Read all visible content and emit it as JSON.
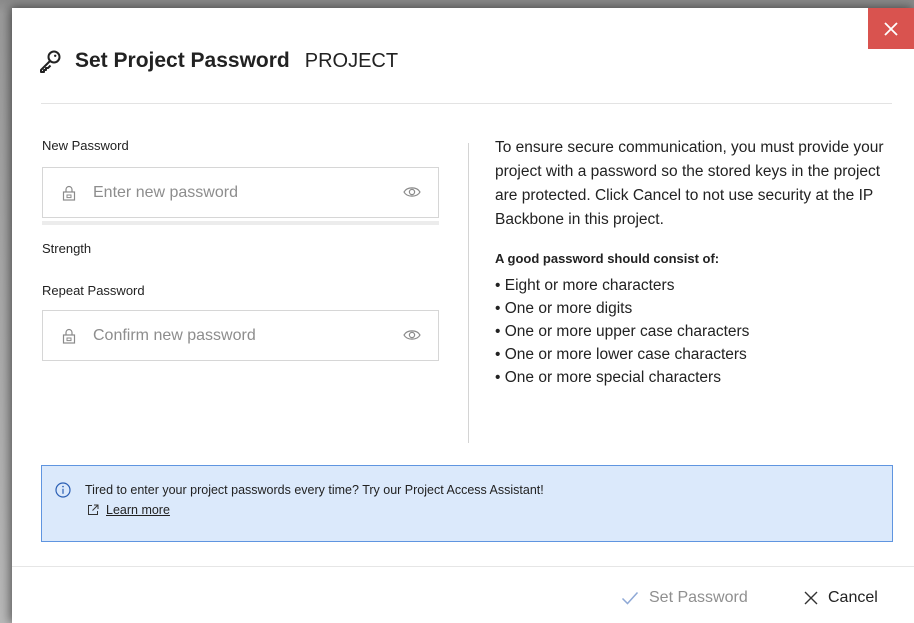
{
  "dialog": {
    "title": "Set Project Password",
    "subtitle": "PROJECT",
    "close_icon": "close-icon"
  },
  "form": {
    "new_password": {
      "label": "New Password",
      "placeholder": "Enter new password",
      "value": ""
    },
    "strength_label": "Strength",
    "repeat_password": {
      "label": "Repeat Password",
      "placeholder": "Confirm new password",
      "value": ""
    }
  },
  "info": {
    "intro": "To ensure secure communication, you must provide your project with a password so the stored keys in the project are protected. Click Cancel to not use security at the IP Backbone in this project.",
    "good_heading": "A good password should consist of:",
    "requirements": [
      "Eight or more characters",
      "One or more digits",
      "One or more upper case characters",
      "One or more lower case characters",
      "One or more special characters"
    ]
  },
  "banner": {
    "text": "Tired to enter your project passwords every time? Try our Project Access Assistant!",
    "link_label": "Learn more"
  },
  "footer": {
    "set_label": "Set Password",
    "cancel_label": "Cancel"
  },
  "colors": {
    "close_bg": "#d9534f",
    "banner_bg": "#dbe9fb",
    "banner_border": "#5f95e0",
    "disabled_text": "#8f8f8f"
  }
}
